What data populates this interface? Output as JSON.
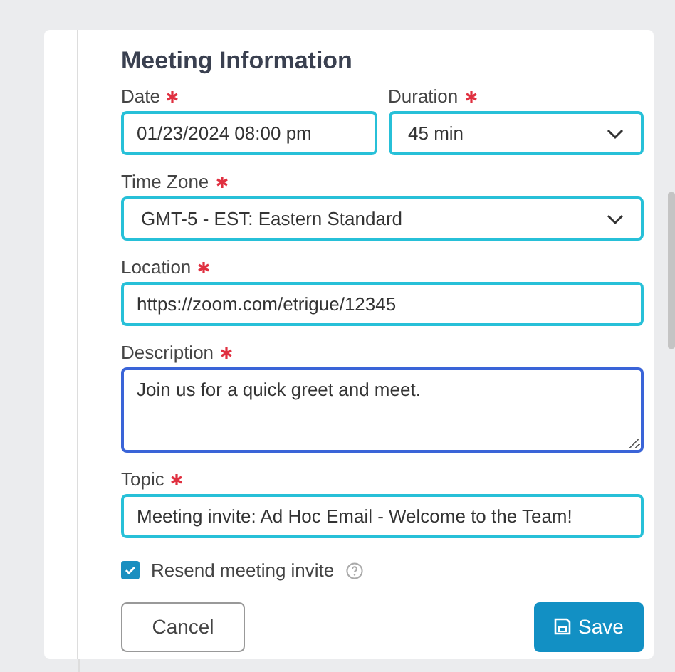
{
  "title": "Meeting Information",
  "rows": [
    [
      {
        "label": "Date",
        "required": true,
        "kind": "input",
        "value": "01/23/2024 08:00 pm",
        "focused": false
      },
      {
        "label": "Duration",
        "required": true,
        "kind": "select",
        "value": "45 min",
        "focused": false
      }
    ],
    [
      {
        "label": "Time Zone",
        "required": true,
        "kind": "select",
        "value": "GMT-5 - EST: Eastern Standard",
        "focused": false
      }
    ],
    [
      {
        "label": "Location",
        "required": true,
        "kind": "input",
        "value": "https://zoom.com/etrigue/12345",
        "focused": false
      }
    ],
    [
      {
        "label": "Description",
        "required": true,
        "kind": "textarea",
        "value": "Join us for a quick greet and meet.",
        "focused": true
      }
    ],
    [
      {
        "label": "Topic",
        "required": true,
        "kind": "input",
        "value": "Meeting invite: Ad Hoc Email - Welcome to the Team!",
        "focused": false
      }
    ]
  ],
  "checkbox": {
    "label": "Resend meeting invite",
    "checked": true
  },
  "buttons": [
    {
      "label": "Cancel",
      "kind": "secondary"
    },
    {
      "label": "Save",
      "kind": "primary"
    }
  ]
}
